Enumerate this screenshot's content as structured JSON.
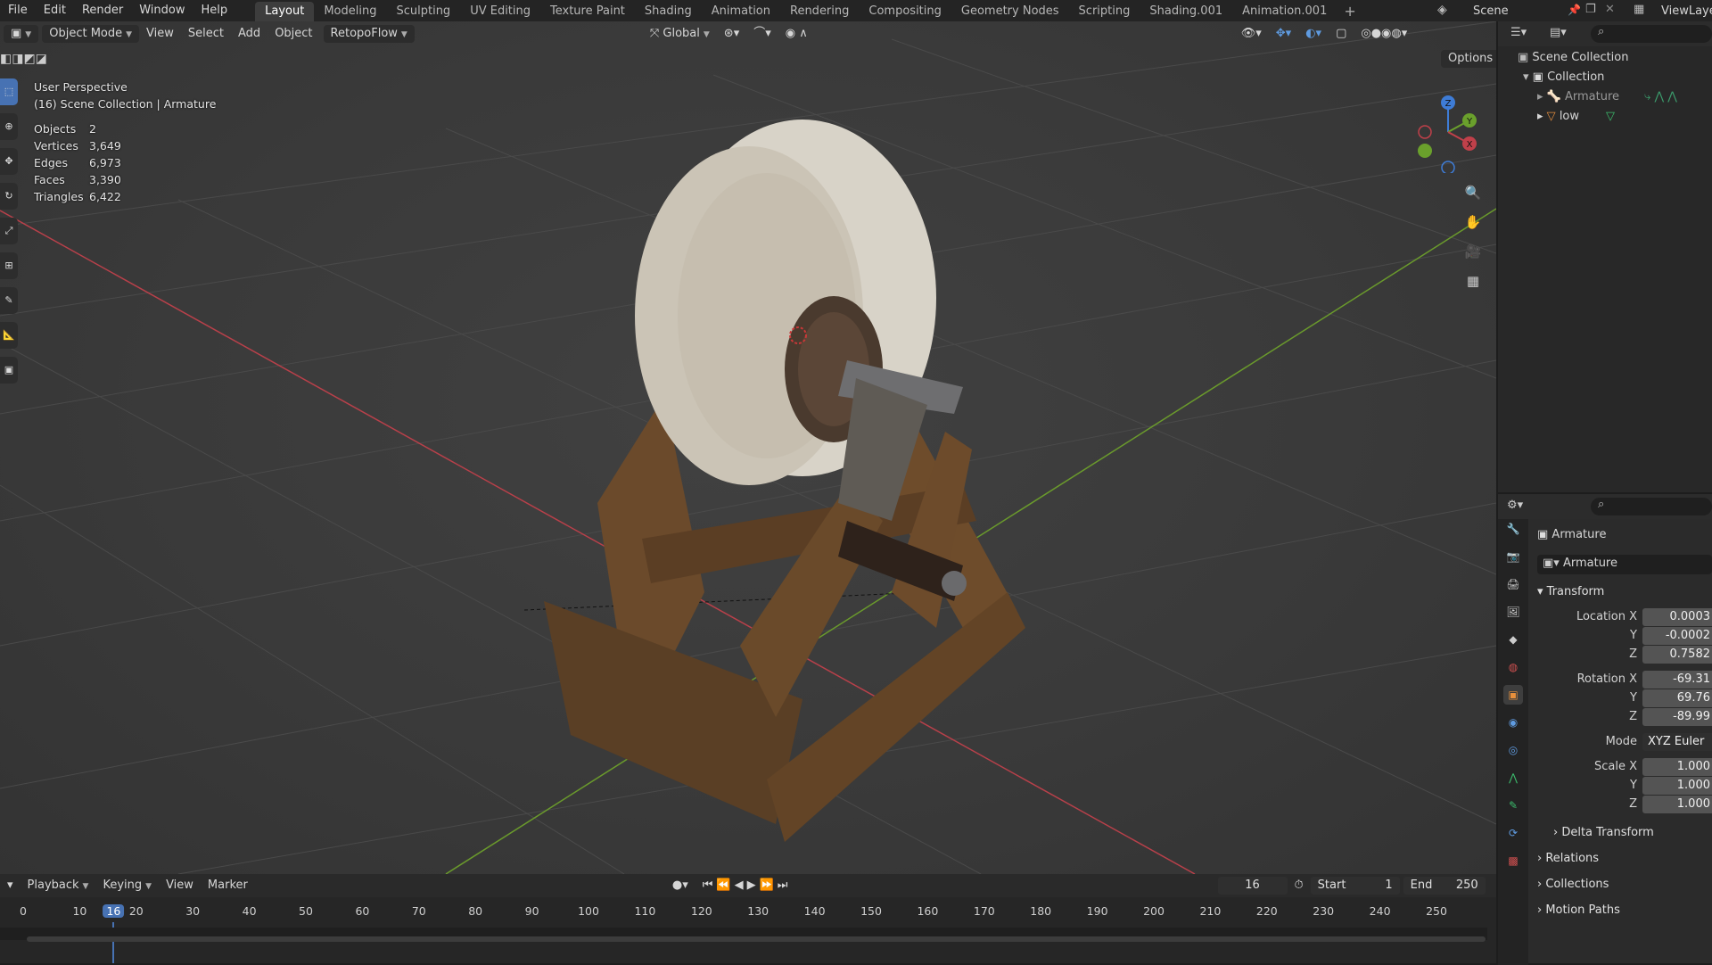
{
  "topbar": {
    "menus": [
      "File",
      "Edit",
      "Render",
      "Window",
      "Help"
    ],
    "workspaces": [
      "Layout",
      "Modeling",
      "Sculpting",
      "UV Editing",
      "Texture Paint",
      "Shading",
      "Animation",
      "Rendering",
      "Compositing",
      "Geometry Nodes",
      "Scripting",
      "Shading.001",
      "Animation.001"
    ],
    "active_workspace": "Layout",
    "add_tab": "+",
    "scene": "Scene",
    "view_layer": "ViewLayer"
  },
  "viewport": {
    "mode": "Object Mode",
    "menus": [
      "View",
      "Select",
      "Add",
      "Object"
    ],
    "addon": "RetopoFlow",
    "orientation": "Global",
    "options": "Options",
    "perspective": "User Perspective",
    "context": "(16) Scene Collection | Armature",
    "stats": [
      {
        "label": "Objects",
        "value": "2"
      },
      {
        "label": "Vertices",
        "value": "3,649"
      },
      {
        "label": "Edges",
        "value": "6,973"
      },
      {
        "label": "Faces",
        "value": "3,390"
      },
      {
        "label": "Triangles",
        "value": "6,422"
      }
    ],
    "gizmo": {
      "z": "Z",
      "y": "Y",
      "x": "X"
    },
    "colors": {
      "x_axis": "#c0404a",
      "y_axis": "#6aa02c",
      "z_axis": "#3e7cd6"
    }
  },
  "timeline": {
    "menus": [
      "Playback",
      "Keying",
      "View",
      "Marker"
    ],
    "current_frame": "16",
    "start_label": "Start",
    "start": "1",
    "end_label": "End",
    "end": "250",
    "ticks": [
      "0",
      "10",
      "20",
      "30",
      "40",
      "50",
      "60",
      "70",
      "80",
      "90",
      "100",
      "110",
      "120",
      "130",
      "140",
      "150",
      "160",
      "170",
      "180",
      "190",
      "200",
      "210",
      "220",
      "230",
      "240",
      "250"
    ]
  },
  "outliner": {
    "root": "Scene Collection",
    "collection": "Collection",
    "items": [
      "Armature",
      "low"
    ]
  },
  "properties": {
    "object_name": "Armature",
    "datablock": "Armature",
    "transform": "Transform",
    "location_label": "Location X",
    "location": [
      "0.0003",
      "-0.0002",
      "0.7582"
    ],
    "rotation_label": "Rotation X",
    "rotation": [
      "-69.31",
      "69.76",
      "-89.99"
    ],
    "mode_label": "Mode",
    "mode": "XYZ Euler",
    "scale_label": "Scale X",
    "scale": [
      "1.000",
      "1.000",
      "1.000"
    ],
    "axis_y": "Y",
    "axis_z": "Z",
    "subpanels": [
      "Delta Transform",
      "Relations",
      "Collections",
      "Motion Paths"
    ]
  }
}
